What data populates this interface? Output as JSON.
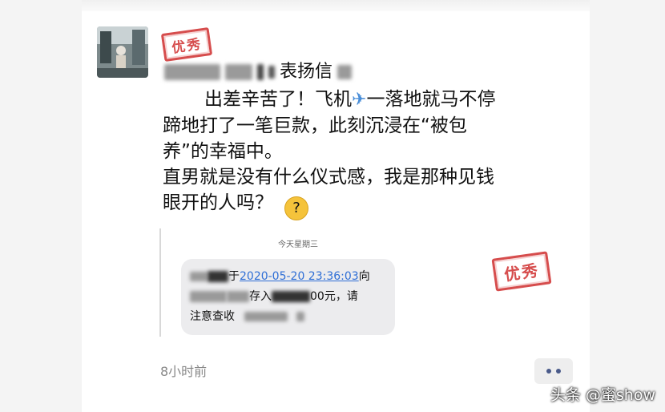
{
  "post": {
    "badge_top": "优秀",
    "title_suffix": "表扬信",
    "line1": "出差辛苦了！飞机",
    "line1_after": "一落地就马不停",
    "line2": "蹄地打了一笔巨款，此刻沉浸在“被包",
    "line3": "养”的幸福中。",
    "line4": "直男就是没有什么仪式感，我是那种见钱",
    "line5": "眼开的人吗？",
    "plane_icon": "airplane-icon",
    "emoji_icon": "thinking-face-icon"
  },
  "quote": {
    "date_label": "今天星期三",
    "sms_part1": "于",
    "sms_link": "2020-05-20 23:36:03",
    "sms_part2": "向",
    "sms_part3": "存入",
    "sms_part4": "00元，请",
    "sms_part5": "注意查收",
    "badge": "优秀"
  },
  "footer": {
    "time": "8小时前",
    "more_icon": "more-dots-icon"
  },
  "watermark": "头条 @蜜show"
}
